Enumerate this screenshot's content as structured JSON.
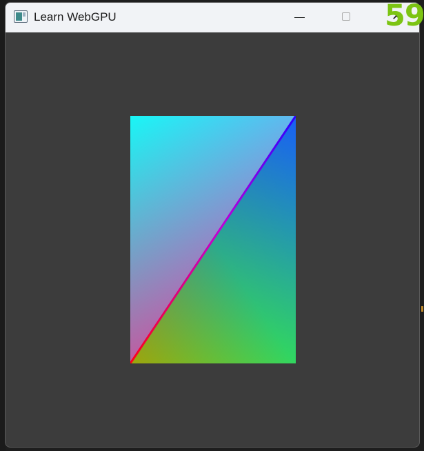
{
  "window": {
    "title": "Learn WebGPU",
    "close_glyph": "✕",
    "minimize_icon": "minimize-icon",
    "maximize_icon": "maximize-icon",
    "close_icon": "close-icon"
  },
  "overlay": {
    "fps_counter": "59",
    "fps_color": "#7cc413"
  },
  "render": {
    "clear_color": "#3c3c3c",
    "vertex_colors": {
      "top_left": "#14ffff",
      "top_right": "#0a10ff",
      "bottom_left": "#ff0018",
      "bottom_right": "#28ff14",
      "diagonal_a": "#ff00ff",
      "diagonal_b": "#ff0000"
    }
  }
}
